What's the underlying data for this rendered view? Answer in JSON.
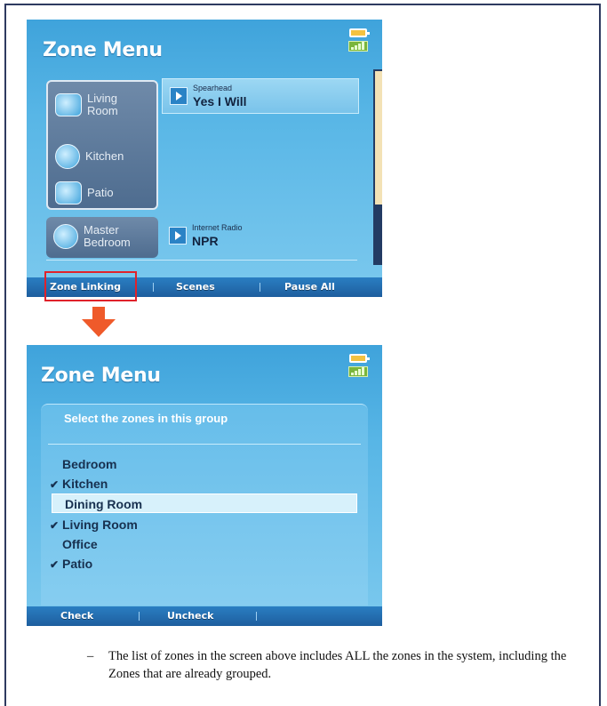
{
  "screen1": {
    "title": "Zone Menu",
    "zones_grouped": [
      {
        "label": "Living Room",
        "icon": "living-room-icon"
      },
      {
        "label": "Kitchen",
        "icon": "kitchen-icon"
      },
      {
        "label": "Patio",
        "icon": "patio-icon"
      }
    ],
    "zone_single": {
      "label": "Master Bedroom",
      "icon": "bedroom-icon"
    },
    "now_playing_1": {
      "source": "Spearhead",
      "title": "Yes I Will"
    },
    "now_playing_2": {
      "source": "Internet Radio",
      "title": "NPR"
    },
    "bottom_bar": [
      "Zone Linking",
      "Scenes",
      "Pause All"
    ]
  },
  "screen2": {
    "title": "Zone Menu",
    "prompt": "Select the zones in this group",
    "zones": [
      {
        "label": "Bedroom",
        "checked": false,
        "highlighted": false
      },
      {
        "label": "Kitchen",
        "checked": true,
        "highlighted": false
      },
      {
        "label": "Dining Room",
        "checked": false,
        "highlighted": true
      },
      {
        "label": "Living Room",
        "checked": true,
        "highlighted": false
      },
      {
        "label": "Office",
        "checked": false,
        "highlighted": false
      },
      {
        "label": "Patio",
        "checked": true,
        "highlighted": false
      }
    ],
    "bottom_bar": [
      "Check",
      "Uncheck"
    ]
  },
  "check_mark": "✔",
  "caption": {
    "dash": "–",
    "text": "The list of zones in the screen above includes ALL the zones in the system, including the Zones that are already grouped."
  },
  "colors": {
    "screen_blue": "#58b6e6",
    "bar_blue": "#1e5e9e",
    "highlight_red": "#e0222b",
    "arrow_orange": "#ef5a2a"
  }
}
